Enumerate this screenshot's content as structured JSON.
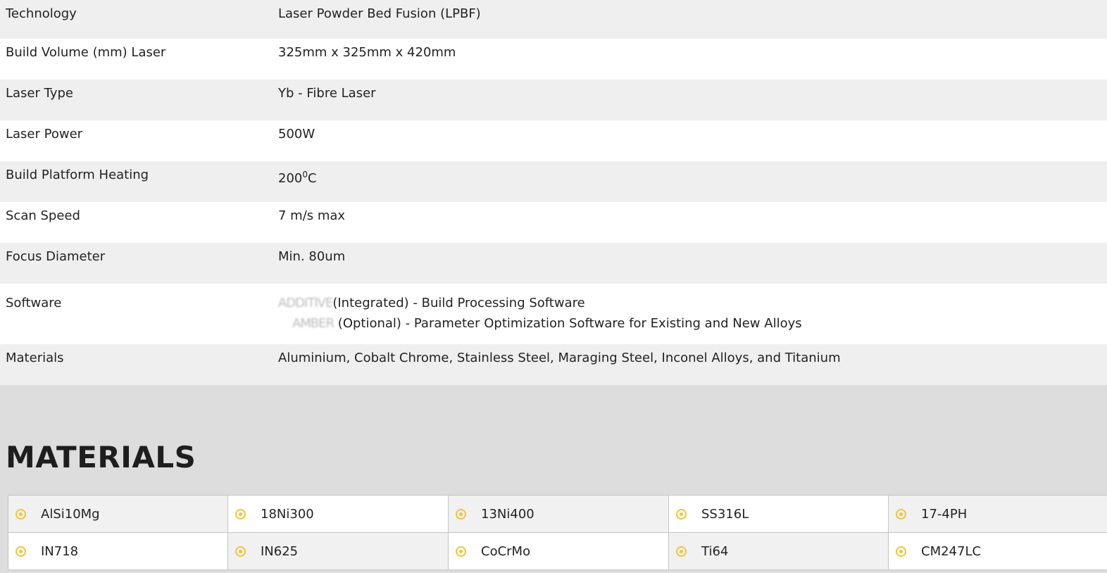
{
  "specs": [
    {
      "label": "Technology",
      "value": "Laser Powder Bed Fusion (LPBF)"
    },
    {
      "label": "Build Volume (mm) Laser",
      "value": "325mm x 325mm x 420mm"
    },
    {
      "label": "Laser Type",
      "value": "Yb - Fibre Laser"
    },
    {
      "label": "Laser Power",
      "value": "500W"
    },
    {
      "label": "Build Platform Heating",
      "value_main": "200",
      "value_sup": "0",
      "value_unit": "C"
    },
    {
      "label": "Scan Speed",
      "value": "7 m/s max"
    },
    {
      "label": "Focus Diameter",
      "value": "Min. 80um"
    },
    {
      "label": "Software",
      "line1_name": "ADDITIVE",
      "line1_text": "(Integrated) - Build Processing Software",
      "line2_name": "AMBER",
      "line2_text": " (Optional) - Parameter Optimization Software for Existing and New Alloys"
    },
    {
      "label": "Materials",
      "value": "Aluminium, Cobalt Chrome, Stainless Steel, Maraging Steel, Inconel Alloys, and Titanium"
    }
  ],
  "materials_section": {
    "title": "MATERIALS",
    "items": [
      "AlSi10Mg",
      "18Ni300",
      "13Ni400",
      "SS316L",
      "17-4PH",
      "IN718",
      "IN625",
      "CoCrMo",
      "Ti64",
      "CM247LC"
    ]
  },
  "colors": {
    "accent": "#f2c531"
  }
}
